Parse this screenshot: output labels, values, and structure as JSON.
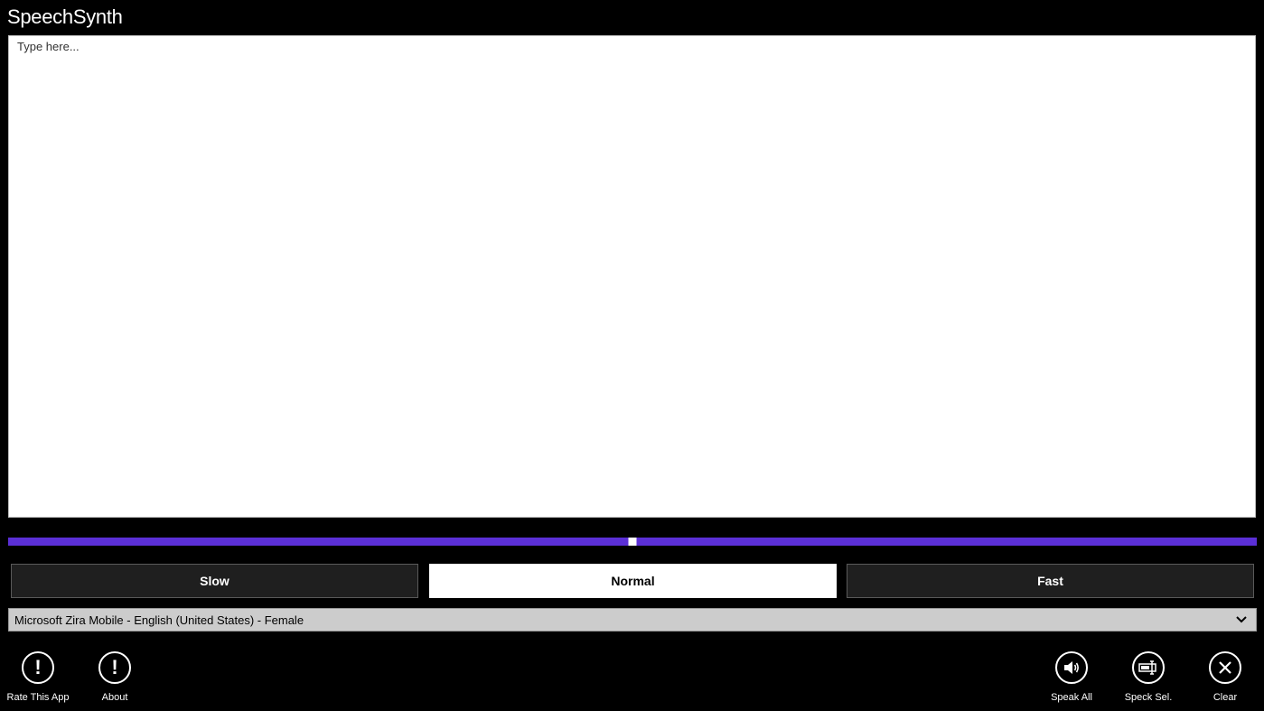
{
  "app": {
    "title": "SpeechSynth"
  },
  "editor": {
    "placeholder": "Type here...",
    "value": ""
  },
  "rate": {
    "level": 0.5,
    "options": [
      "Slow",
      "Normal",
      "Fast"
    ],
    "selected": "Normal"
  },
  "voice": {
    "selected": "Microsoft Zira Mobile - English (United States) - Female"
  },
  "appbar": {
    "left": [
      {
        "label": "Rate This App",
        "icon": "exclamation-icon"
      },
      {
        "label": "About",
        "icon": "exclamation-icon"
      }
    ],
    "right": [
      {
        "label": "Speak All",
        "icon": "speaker-icon"
      },
      {
        "label": "Speck Sel.",
        "icon": "speak-selection-icon"
      },
      {
        "label": "Clear",
        "icon": "close-icon"
      }
    ]
  },
  "colors": {
    "background": "#000000",
    "accent": "#5b2fd6",
    "button_bg": "#1f1f1f",
    "select_bg": "#cccccc"
  }
}
